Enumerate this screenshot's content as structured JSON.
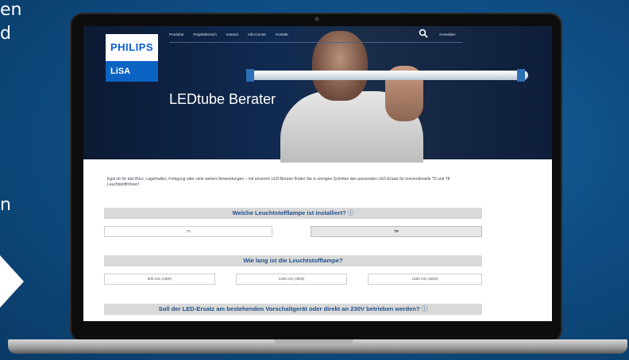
{
  "slide": {
    "left_lines": [
      "en",
      "d",
      "n"
    ]
  },
  "nav": {
    "items": [
      "Produkte",
      "Projektbereich",
      "Interact",
      "Info-Center",
      "Kontakt"
    ],
    "login": "Anmelden"
  },
  "brand": {
    "name": "PHILIPS",
    "sub": "LiSA"
  },
  "hero": {
    "title": "LEDtube Berater"
  },
  "intro": {
    "text": "Egal ob für das Büro, Lagerhallen, Fertigung oder viele weitere Anwendungen – mit unserem LED-Berater finden Sie in wenigen Schritten den passenden LED-Ersatz für konventionelle T5 und T8 Leuchtstoffröhren!"
  },
  "questions": [
    {
      "label": "Welche Leuchtstofflampe ist installiert?",
      "info": "ⓘ",
      "options": [
        "T5",
        "T8"
      ],
      "selected": "T8"
    },
    {
      "label": "Wie lang ist die Leuchtstofflampe?",
      "options": [
        "600 mm (18W)",
        "1200 mm (36W)",
        "1500 mm (58W)"
      ]
    },
    {
      "label": "Soll der LED-Ersatz am bestehenden Vorschaltgerät oder direkt an 230V betrieben werden?",
      "info": "ⓘ"
    }
  ],
  "colors": {
    "background": "#0f4f86",
    "accent": "#1f4f8a",
    "brand_blue": "#0b5ed7"
  }
}
